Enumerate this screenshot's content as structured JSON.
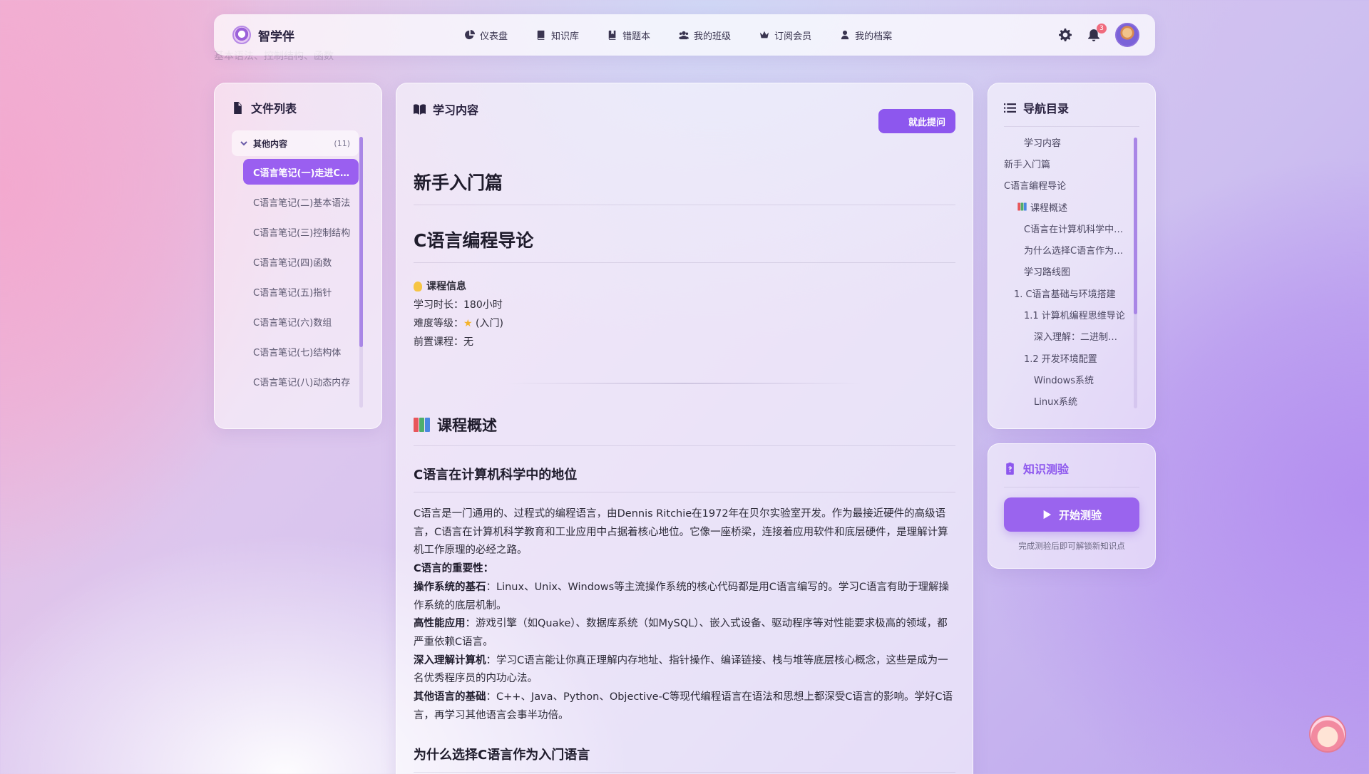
{
  "ghost_text": "基本语法、控制结构、函数",
  "app": {
    "name": "智学伴"
  },
  "nav": {
    "items": [
      {
        "label": "仪表盘",
        "icon": "pie-chart-icon"
      },
      {
        "label": "知识库",
        "icon": "book-icon"
      },
      {
        "label": "错题本",
        "icon": "bookmark-book-icon"
      },
      {
        "label": "我的班级",
        "icon": "users-icon"
      },
      {
        "label": "订阅会员",
        "icon": "crown-icon"
      },
      {
        "label": "我的档案",
        "icon": "user-icon"
      }
    ],
    "notification_count": "3"
  },
  "files": {
    "title": "文件列表",
    "folder": {
      "name": "其他内容",
      "count": "(11)"
    },
    "items": [
      "C语言笔记(一)走进C语言",
      "C语言笔记(二)基本语法",
      "C语言笔记(三)控制结构",
      "C语言笔记(四)函数",
      "C语言笔记(五)指针",
      "C语言笔记(六)数组",
      "C语言笔记(七)结构体",
      "C语言笔记(八)动态内存"
    ]
  },
  "main": {
    "header": "学习内容",
    "ask_button": "就此提问",
    "h1": "新手入门篇",
    "h1b": "C语言编程导论",
    "info": {
      "title": "课程信息",
      "duration_label": "学习时长：",
      "duration_value": "180小时",
      "difficulty_label": "难度等级：",
      "difficulty_value": "(入门)",
      "prereq_label": "前置课程：",
      "prereq_value": "无"
    },
    "h2": "课程概述",
    "h3": "C语言在计算机科学中的地位",
    "intro": "C语言是一门通用的、过程式的编程语言，由Dennis Ritchie在1972年在贝尔实验室开发。作为最接近硬件的高级语言，C语言在计算机科学教育和工业应用中占据着核心地位。它像一座桥梁，连接着应用软件和底层硬件，是理解计算机工作原理的必经之路。",
    "importance_title": "C语言的重要性：",
    "points": [
      {
        "title": "操作系统的基石",
        "text": "：Linux、Unix、Windows等主流操作系统的核心代码都是用C语言编写的。学习C语言有助于理解操作系统的底层机制。"
      },
      {
        "title": "高性能应用",
        "text": "：游戏引擎（如Quake）、数据库系统（如MySQL）、嵌入式设备、驱动程序等对性能要求极高的领域，都严重依赖C语言。"
      },
      {
        "title": "深入理解计算机",
        "text": "：学习C语言能让你真正理解内存地址、指针操作、编译链接、栈与堆等底层核心概念，这些是成为一名优秀程序员的内功心法。"
      },
      {
        "title": "其他语言的基础",
        "text": "：C++、Java、Python、Objective-C等现代编程语言在语法和思想上都深受C语言的影响。学好C语言，再学习其他语言会事半功倍。"
      }
    ],
    "h3b": "为什么选择C语言作为入门语言"
  },
  "toc": {
    "title": "导航目录",
    "items": [
      {
        "label": "学习内容",
        "indent": 2
      },
      {
        "label": "新手入门篇",
        "indent": 0
      },
      {
        "label": "C语言编程导论",
        "indent": 0
      },
      {
        "label": "课程概述",
        "indent": 1,
        "icon": "books-icon"
      },
      {
        "label": "C语言在计算机科学中的地位",
        "indent": 2
      },
      {
        "label": "为什么选择C语言作为入门语言",
        "indent": 2
      },
      {
        "label": "学习路线图",
        "indent": 2
      },
      {
        "label": "1. C语言基础与环境搭建",
        "indent": 1
      },
      {
        "label": "1.1 计算机编程思维导论",
        "indent": 2
      },
      {
        "label": "深入理解：二进制与计算机",
        "indent": 3
      },
      {
        "label": "1.2 开发环境配置",
        "indent": 2
      },
      {
        "label": "Windows系统",
        "indent": 3
      },
      {
        "label": "Linux系统",
        "indent": 3
      }
    ]
  },
  "quiz": {
    "title": "知识测验",
    "button": "开始测验",
    "hint": "完成测验后即可解锁新知识点"
  },
  "colors": {
    "accent": "#8d57ee",
    "active_file": "#9a5ff0"
  }
}
